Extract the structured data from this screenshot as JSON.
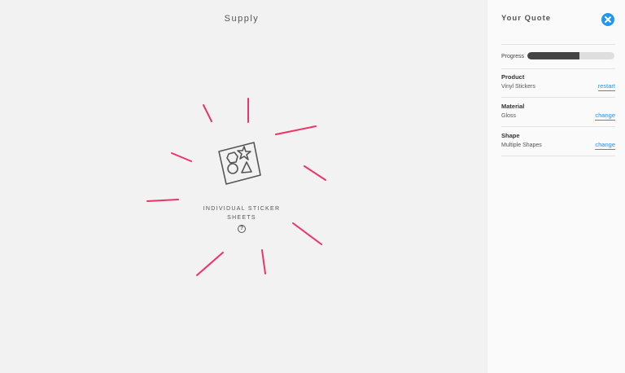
{
  "main": {
    "title": "Supply",
    "option": {
      "label_line1": "INDIVIDUAL STICKER",
      "label_line2": "SHEETS",
      "help_glyph": "?",
      "icon": "sticker-sheet-icon"
    },
    "ray_color": "#ee3366"
  },
  "sidebar": {
    "title": "Your Quote",
    "close_icon": "close-icon",
    "accent_color": "#2196f3",
    "progress": {
      "label": "Progress",
      "fraction": 0.6
    },
    "rows": [
      {
        "label": "Product",
        "value": "Vinyl Stickers",
        "link": "restart"
      },
      {
        "label": "Material",
        "value": "Gloss",
        "link": "change"
      },
      {
        "label": "Shape",
        "value": "Multiple Shapes",
        "link": "change"
      }
    ]
  }
}
